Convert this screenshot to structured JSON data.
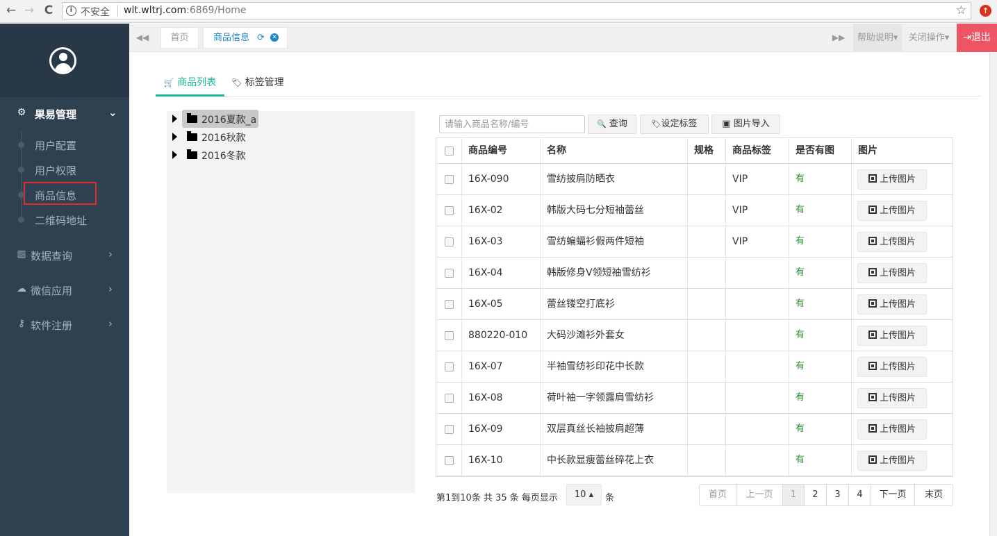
{
  "browser": {
    "back": "←",
    "forward": "→",
    "reload": "C",
    "not_secure": "不安全",
    "host": "wlt.wltrj.com",
    "path": ":6869/Home",
    "star": "☆",
    "ext_badge": "↑"
  },
  "sidebar": {
    "group_main": {
      "label": "果易管理",
      "icon": "gears-icon",
      "chevron": "⌄"
    },
    "sub_items": [
      {
        "label": "用户配置"
      },
      {
        "label": "用户权限"
      },
      {
        "label": "商品信息",
        "highlighted": true
      },
      {
        "label": "二维码地址"
      }
    ],
    "groups": [
      {
        "label": "数据查询",
        "icon": "bar-chart-icon",
        "glyph": "▥",
        "chevron": "›"
      },
      {
        "label": "微信应用",
        "icon": "wechat-icon",
        "glyph": "☁",
        "chevron": "›"
      },
      {
        "label": "软件注册",
        "icon": "key-icon",
        "glyph": "⚷",
        "chevron": "›"
      }
    ]
  },
  "topbar": {
    "left_arrow": "◀◀",
    "right_arrow": "▶▶",
    "tabs": [
      {
        "label": "首页"
      },
      {
        "label": "商品信息",
        "active": true,
        "refresh": "⟳",
        "close": "✕"
      }
    ],
    "help": "帮助说明▾",
    "close_ops": "关闭操作▾",
    "logout": "退出",
    "logout_icon": "⇥"
  },
  "content": {
    "tabs": [
      {
        "label": "商品列表",
        "icon": "cart-icon",
        "glyph": "🛒"
      },
      {
        "label": "标签管理",
        "icon": "tags-icon",
        "glyph": "🏷"
      }
    ],
    "tree": [
      {
        "label": "2016夏款_a",
        "selected": true
      },
      {
        "label": "2016秋款"
      },
      {
        "label": "2016冬款"
      }
    ],
    "search_placeholder": "请输入商品名称/编号",
    "buttons": {
      "query": "查询",
      "query_icon": "🔍",
      "set_tag": "设定标签",
      "set_tag_icon": "🏷",
      "import": "图片导入",
      "import_icon": "▣"
    },
    "table": {
      "columns": [
        "商品编号",
        "名称",
        "规格",
        "商品标签",
        "是否有图",
        "图片"
      ],
      "upload_label": "上传图片",
      "rows": [
        {
          "code": "16X-090",
          "name": "雪纺披肩防晒衣",
          "spec": "",
          "tag": "VIP",
          "has_img": "有"
        },
        {
          "code": "16X-02",
          "name": "韩版大码七分短袖蕾丝",
          "spec": "",
          "tag": "VIP",
          "has_img": "有"
        },
        {
          "code": "16X-03",
          "name": "雪纺蝙蝠衫假两件短袖",
          "spec": "",
          "tag": "VIP",
          "has_img": "有"
        },
        {
          "code": "16X-04",
          "name": "韩版修身V领短袖雪纺衫",
          "spec": "",
          "tag": "",
          "has_img": "有"
        },
        {
          "code": "16X-05",
          "name": "蕾丝镂空打底衫",
          "spec": "",
          "tag": "",
          "has_img": "有"
        },
        {
          "code": "880220-010",
          "name": "大码沙滩衫外套女",
          "spec": "",
          "tag": "",
          "has_img": "有"
        },
        {
          "code": "16X-07",
          "name": "半袖雪纺衫印花中长款",
          "spec": "",
          "tag": "",
          "has_img": "有"
        },
        {
          "code": "16X-08",
          "name": "荷叶袖一字领露肩雪纺衫",
          "spec": "",
          "tag": "",
          "has_img": "有"
        },
        {
          "code": "16X-09",
          "name": "双层真丝长袖披肩超薄",
          "spec": "",
          "tag": "",
          "has_img": "有"
        },
        {
          "code": "16X-10",
          "name": "中长款显瘦蕾丝碎花上衣",
          "spec": "",
          "tag": "",
          "has_img": "有"
        }
      ]
    },
    "pager": {
      "info": "第1到10条 共 35 条 每页显示",
      "page_size": "10 ▴",
      "unit": "条",
      "first": "首页",
      "prev": "上一页",
      "pages": [
        "1",
        "2",
        "3",
        "4"
      ],
      "next": "下一页",
      "last": "末页",
      "current": "1"
    }
  }
}
